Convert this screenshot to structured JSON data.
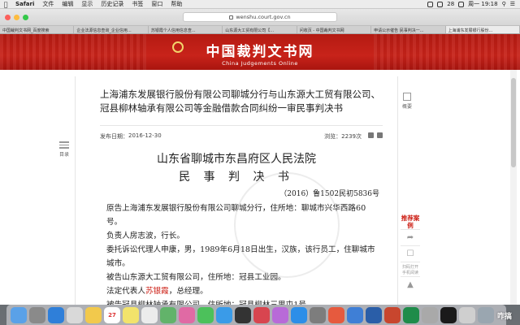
{
  "menubar": {
    "app_name": "Safari",
    "items": [
      "文件",
      "编辑",
      "显示",
      "历史记录",
      "书签",
      "窗口",
      "帮助"
    ],
    "battery": "28",
    "time": "周一 19:18"
  },
  "browser": {
    "url": "wenshu.court.gov.cn",
    "tabs": [
      "中国裁判文书网_百度搜索",
      "企业法源信息查询_企业信用...",
      "苏银霞个人信用信息查...",
      "山东源大工贸有限公司【...",
      "问收页 - 中国裁判文书网",
      "申请公示催告 民事判决一...",
      "上海浦东发展银行股份..."
    ]
  },
  "site": {
    "title": "中国裁判文书网",
    "subtitle": "China Judgements Online"
  },
  "document": {
    "title": "上海浦东发展银行股份有限公司聊城分行与山东源大工贸有限公司、冠县柳林轴承有限公司等金融借款合同纠纷一审民事判决书",
    "publish_label": "发布日期：",
    "publish_date": "2016-12-30",
    "views_label": "浏览：",
    "views": "2239次",
    "court": "山东省聊城市东昌府区人民法院",
    "doc_type": "民 事 判 决 书",
    "case_number": "（2016）鲁1502民初5836号",
    "paragraphs": [
      "原告上海浦东发展银行股份有限公司聊城分行，住所地：聊城市兴华西路60号。",
      "负责人房志波，行长。",
      "委托诉讼代理人申康，男，1989年6月18日出生，汉族，该行员工，住聊城市城市。",
      "被告山东源大工贸有限公司，住所地：冠县工业园。"
    ],
    "rep_prefix": "法定代表人",
    "rep_name": "苏银霞",
    "rep_suffix": "，总经理。",
    "last_line": "被告冠县柳林轴承有限公司，住所地：冠县柳林三里屯1号。"
  },
  "outline": {
    "label": "目录"
  },
  "summary": {
    "label": "概要"
  },
  "side": {
    "recommend": "推荐案例",
    "qr_label": "扫码打开手机阅读"
  },
  "dock": {
    "calendar_day": "27",
    "watermark": "咋搞"
  },
  "colors": {
    "banner_red": "#c8231a",
    "highlight_red": "#cc1c12"
  }
}
